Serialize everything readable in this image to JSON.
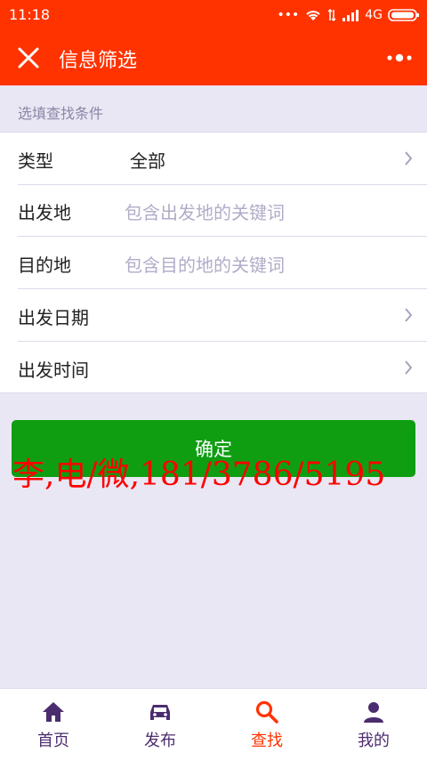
{
  "status_bar": {
    "time": "11:18",
    "network": "4G"
  },
  "header": {
    "title": "信息筛选"
  },
  "section": {
    "hint": "选填查找条件"
  },
  "form": {
    "type": {
      "label": "类型",
      "value": "全部"
    },
    "origin": {
      "label": "出发地",
      "placeholder": "包含出发地的关键词"
    },
    "destination": {
      "label": "目的地",
      "placeholder": "包含目的地的关键词"
    },
    "date": {
      "label": "出发日期"
    },
    "time": {
      "label": "出发时间"
    }
  },
  "confirm": {
    "label": "确定"
  },
  "watermark": {
    "text": "李,电/微,181/3786/5195"
  },
  "tabbar": {
    "tabs": [
      {
        "label": "首页",
        "icon": "home-icon",
        "active": false
      },
      {
        "label": "发布",
        "icon": "car-icon",
        "active": false
      },
      {
        "label": "查找",
        "icon": "search-icon",
        "active": true
      },
      {
        "label": "我的",
        "icon": "user-icon",
        "active": false
      }
    ]
  },
  "colors": {
    "primary": "#ff3300",
    "confirm": "#0f9e12",
    "background": "#e9e7f4",
    "tab_inactive": "#4b2c6e",
    "watermark": "#ff0000"
  }
}
